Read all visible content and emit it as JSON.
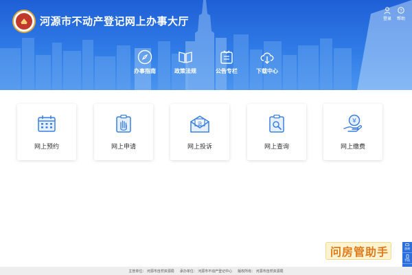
{
  "header": {
    "site_title": "河源市不动产登记网上办事大厅",
    "tools": [
      {
        "label": "登录",
        "icon": "user-icon"
      },
      {
        "label": "帮助",
        "icon": "help-icon"
      }
    ]
  },
  "nav": {
    "items": [
      {
        "label": "办事指南",
        "icon": "compass-icon"
      },
      {
        "label": "政策法规",
        "icon": "book-icon"
      },
      {
        "label": "公告专栏",
        "icon": "bulletin-icon"
      },
      {
        "label": "下载中心",
        "icon": "cloud-download-icon"
      }
    ]
  },
  "services": [
    {
      "label": "网上预约",
      "icon": "calendar-icon"
    },
    {
      "label": "网上申请",
      "icon": "hand-clipboard-icon"
    },
    {
      "label": "网上投诉",
      "icon": "complaint-envelope-icon",
      "icon_text": "诉"
    },
    {
      "label": "网上查询",
      "icon": "search-document-icon"
    },
    {
      "label": "网上缴费",
      "icon": "yuan-coin-hand-icon",
      "icon_text": "¥"
    }
  ],
  "helper": {
    "label": "问房管助手"
  },
  "side_bar": [
    {
      "label": "咨询",
      "icon": "chat-icon"
    },
    {
      "label": "手机",
      "icon": "phone-icon"
    },
    {
      "label": "回顶",
      "icon": "arrow-up-icon"
    }
  ],
  "footer": {
    "host": "主管单位：  河源市自然资源局",
    "organizer": "承办单位：  河源市不动产登记中心",
    "copyright": "版权所有：  河源市自然资源局"
  },
  "colors": {
    "brand_blue": "#2f7be6",
    "icon_blue": "#3a7fe0",
    "helper_orange": "#e07b1a"
  }
}
